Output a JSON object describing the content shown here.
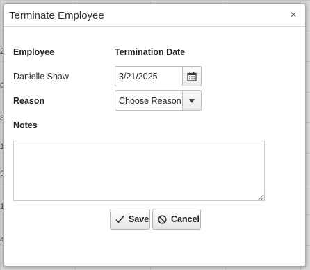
{
  "background": {
    "numbers": [
      "2",
      "0",
      "8",
      "1",
      "5",
      "1",
      "4"
    ]
  },
  "dialog": {
    "title": "Terminate Employee",
    "close_glyph": "×",
    "employee_label": "Employee",
    "employee_name": "Danielle Shaw",
    "termination_date_label": "Termination Date",
    "termination_date_value": "3/21/2025",
    "reason_label": "Reason",
    "reason_selected": "Choose Reason",
    "notes_label": "Notes",
    "notes_value": "",
    "save_label": "Save",
    "cancel_label": "Cancel"
  },
  "icons": {
    "calendar": "calendar-icon",
    "dropdown": "chevron-down-icon",
    "save": "checkmark-icon",
    "cancel": "ban-icon",
    "close": "close-icon"
  }
}
